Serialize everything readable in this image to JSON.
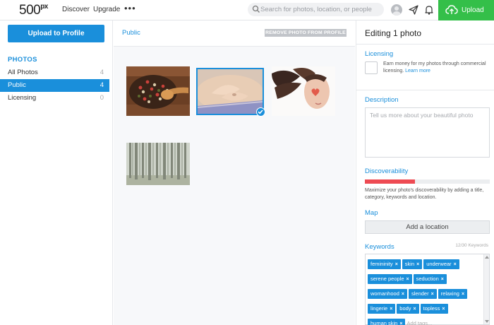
{
  "nav": {
    "logo_text": "500",
    "logo_sup": "px",
    "discover": "Discover",
    "upgrade": "Upgrade",
    "more": "•••",
    "search_placeholder": "Search for photos, location, or people",
    "upload_label": "Upload"
  },
  "sidebar": {
    "upload_button": "Upload to Profile",
    "section_heading": "PHOTOS",
    "items": [
      {
        "label": "All Photos",
        "count": "4",
        "active": false
      },
      {
        "label": "Public",
        "count": "4",
        "active": true
      },
      {
        "label": "Licensing",
        "count": "0",
        "active": false
      }
    ]
  },
  "center": {
    "breadcrumb": "Public",
    "remove_button": "REMOVE PHOTO FROM PROFILE",
    "photos": [
      {
        "subject": "peppercorns-and-spoon",
        "selected": false
      },
      {
        "subject": "hands-on-belly",
        "selected": true
      },
      {
        "subject": "woman-with-hair-and-heart",
        "selected": false
      },
      {
        "subject": "foggy-forest",
        "selected": false
      }
    ]
  },
  "panel": {
    "title": "Editing 1 photo",
    "licensing_label": "Licensing",
    "licensing_text": "Earn money for my photos through commercial licensing.",
    "learn_more": "Learn more",
    "description_label": "Description",
    "description_placeholder": "Tell us more about your beautiful photo",
    "discoverability_label": "Discoverability",
    "discoverability_level": 0.4,
    "discoverability_text": "Maximize your photo's discoverability by adding a title, category, keywords and location.",
    "map_label": "Map",
    "add_location": "Add a location",
    "keywords_label": "Keywords",
    "keywords_count": "12/30 Keywords",
    "keywords": [
      "femininity",
      "skin",
      "underwear",
      "serene people",
      "seduction",
      "womanhood",
      "slender",
      "relaxing",
      "lingerie",
      "body",
      "topless",
      "human skin"
    ],
    "add_tags_placeholder": "Add tags..."
  },
  "colors": {
    "accent": "#1a8fdb",
    "upload_green": "#34bf49",
    "meter_red": "#ee4b53"
  }
}
